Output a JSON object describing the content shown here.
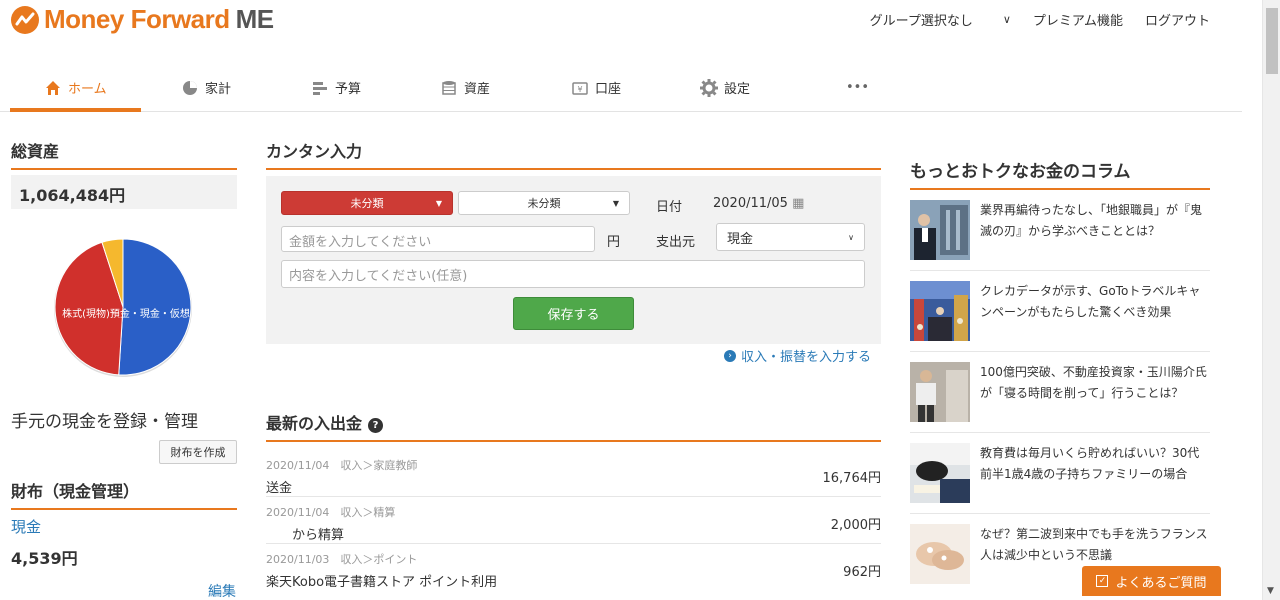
{
  "header": {
    "logo_text": "Money Forward",
    "logo_me": "ME",
    "group_select": "グループ選択なし",
    "premium": "プレミアム機能",
    "logout": "ログアウト"
  },
  "nav": [
    {
      "label": "ホーム",
      "icon": "home-icon"
    },
    {
      "label": "家計",
      "icon": "pie-chart-icon"
    },
    {
      "label": "予算",
      "icon": "budget-icon"
    },
    {
      "label": "資産",
      "icon": "coins-icon"
    },
    {
      "label": "口座",
      "icon": "wallet-icon"
    },
    {
      "label": "設定",
      "icon": "gear-icon"
    },
    {
      "label": "•••",
      "icon": "more-icon"
    }
  ],
  "total_assets": {
    "heading": "総資産",
    "value": "1,064,484円",
    "pie_label": "株式(現物)預金・現金・仮想",
    "pie": [
      {
        "name": "預金・現金・仮想",
        "fraction": 0.51,
        "color": "#2a5fc7"
      },
      {
        "name": "株式(現物)",
        "fraction": 0.44,
        "color": "#d0302c"
      },
      {
        "name": "other",
        "fraction": 0.05,
        "color": "#f5b82e"
      }
    ]
  },
  "cash": {
    "manage_text": "手元の現金を登録・管理",
    "create_wallet": "財布を作成",
    "wallet_heading": "財布（現金管理）",
    "cash_label": "現金",
    "cash_value": "4,539円",
    "edit": "編集"
  },
  "quick_input": {
    "heading": "カンタン入力",
    "category_main": "未分類",
    "category_sub": "未分類",
    "date_label": "日付",
    "date_value": "2020/11/05",
    "amount_placeholder": "金額を入力してください",
    "yen": "円",
    "source_label": "支出元",
    "source_value": "現金",
    "memo_placeholder": "内容を入力してください(任意)",
    "save": "保存する",
    "income_link": "収入・振替を入力する"
  },
  "recent": {
    "heading": "最新の入出金",
    "items": [
      {
        "meta": "2020/11/04　収入＞家庭教師",
        "desc": "送金",
        "amount": "16,764円"
      },
      {
        "meta": "2020/11/04　収入＞精算",
        "desc": "　　から精算",
        "amount": "2,000円"
      },
      {
        "meta": "2020/11/03　収入＞ポイント",
        "desc": "楽天Kobo電子書籍ストア ポイント利用",
        "amount": "962円"
      }
    ]
  },
  "columns": {
    "heading": "もっとおトクなお金のコラム",
    "items": [
      {
        "title": "業界再編待ったなし、「地銀職員」が『鬼滅の刃』から学ぶべきこととは？"
      },
      {
        "title": "クレカデータが示す、GoToトラベルキャンペーンがもたらした驚くべき効果"
      },
      {
        "title": "100億円突破、不動産投資家・玉川陽介氏が「寝る時間を削って」行うことは？"
      },
      {
        "title": "教育費は毎月いくら貯めればいい？30代前半1歳4歳の子持ちファミリーの場合"
      },
      {
        "title": "なぜ？第二波到来中でも手を洗うフランス人は減少中という不思議"
      }
    ]
  },
  "faq": "よくあるご質問"
}
